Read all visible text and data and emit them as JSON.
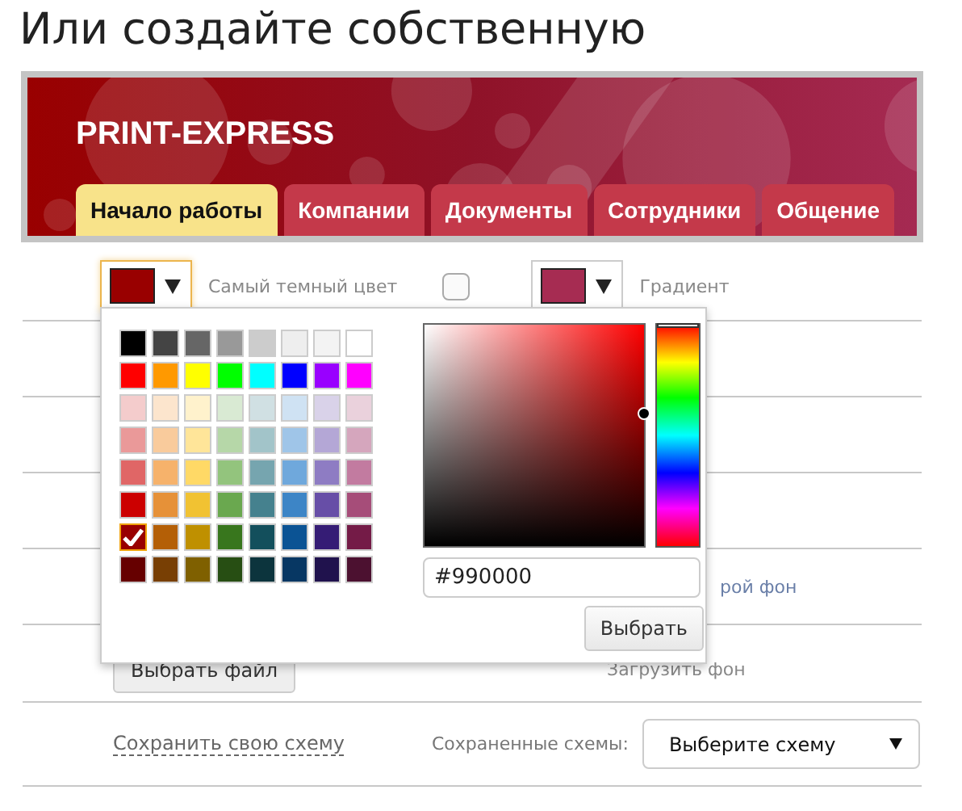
{
  "heading": "Или создайте собственную",
  "banner": {
    "logo": "PRINT-EXPRESS",
    "tabs": [
      {
        "label": "Начало работы",
        "selected": true
      },
      {
        "label": "Компании",
        "selected": false
      },
      {
        "label": "Документы",
        "selected": false
      },
      {
        "label": "Сотрудники",
        "selected": false
      },
      {
        "label": "Общение",
        "selected": false
      }
    ]
  },
  "color_row": {
    "darkest": {
      "color": "#990000",
      "label": "Самый темный цвет"
    },
    "gradient_checkbox": {
      "checked": false
    },
    "gradient": {
      "color": "#a62c52",
      "label": "Градиент"
    }
  },
  "picker": {
    "palette": [
      [
        {
          "color": "#000000",
          "selected": false
        },
        {
          "color": "#444444",
          "selected": false
        },
        {
          "color": "#666666",
          "selected": false
        },
        {
          "color": "#999999",
          "selected": false
        },
        {
          "color": "#cccccc",
          "selected": false
        },
        {
          "color": "#eeeeee",
          "selected": false
        },
        {
          "color": "#f3f3f3",
          "selected": false
        },
        {
          "color": "#ffffff",
          "selected": false
        }
      ],
      [
        {
          "color": "#ff0000",
          "selected": false
        },
        {
          "color": "#ff9900",
          "selected": false
        },
        {
          "color": "#ffff00",
          "selected": false
        },
        {
          "color": "#00ff00",
          "selected": false
        },
        {
          "color": "#00ffff",
          "selected": false
        },
        {
          "color": "#0000ff",
          "selected": false
        },
        {
          "color": "#9900ff",
          "selected": false
        },
        {
          "color": "#ff00ff",
          "selected": false
        }
      ],
      [
        {
          "color": "#f4cccc",
          "selected": false
        },
        {
          "color": "#fce5cd",
          "selected": false
        },
        {
          "color": "#fff2cc",
          "selected": false
        },
        {
          "color": "#d9ead3",
          "selected": false
        },
        {
          "color": "#d0e0e3",
          "selected": false
        },
        {
          "color": "#cfe2f3",
          "selected": false
        },
        {
          "color": "#d9d2e9",
          "selected": false
        },
        {
          "color": "#ead1dc",
          "selected": false
        }
      ],
      [
        {
          "color": "#ea9999",
          "selected": false
        },
        {
          "color": "#f9cb9c",
          "selected": false
        },
        {
          "color": "#ffe599",
          "selected": false
        },
        {
          "color": "#b6d7a8",
          "selected": false
        },
        {
          "color": "#a2c4c9",
          "selected": false
        },
        {
          "color": "#9fc5e8",
          "selected": false
        },
        {
          "color": "#b4a7d6",
          "selected": false
        },
        {
          "color": "#d5a6bd",
          "selected": false
        }
      ],
      [
        {
          "color": "#e06666",
          "selected": false
        },
        {
          "color": "#f6b26b",
          "selected": false
        },
        {
          "color": "#ffd966",
          "selected": false
        },
        {
          "color": "#93c47d",
          "selected": false
        },
        {
          "color": "#76a5af",
          "selected": false
        },
        {
          "color": "#6fa8dc",
          "selected": false
        },
        {
          "color": "#8e7cc3",
          "selected": false
        },
        {
          "color": "#c27ba0",
          "selected": false
        }
      ],
      [
        {
          "color": "#cc0000",
          "selected": false
        },
        {
          "color": "#e69138",
          "selected": false
        },
        {
          "color": "#f1c232",
          "selected": false
        },
        {
          "color": "#6aa84f",
          "selected": false
        },
        {
          "color": "#45818e",
          "selected": false
        },
        {
          "color": "#3d85c6",
          "selected": false
        },
        {
          "color": "#674ea7",
          "selected": false
        },
        {
          "color": "#a64d79",
          "selected": false
        }
      ],
      [
        {
          "color": "#990000",
          "selected": true
        },
        {
          "color": "#b45f06",
          "selected": false
        },
        {
          "color": "#bf9000",
          "selected": false
        },
        {
          "color": "#38761d",
          "selected": false
        },
        {
          "color": "#134f5c",
          "selected": false
        },
        {
          "color": "#0b5394",
          "selected": false
        },
        {
          "color": "#351c75",
          "selected": false
        },
        {
          "color": "#741b47",
          "selected": false
        }
      ],
      [
        {
          "color": "#660000",
          "selected": false
        },
        {
          "color": "#783f04",
          "selected": false
        },
        {
          "color": "#7f6000",
          "selected": false
        },
        {
          "color": "#274e13",
          "selected": false
        },
        {
          "color": "#0c343d",
          "selected": false
        },
        {
          "color": "#073763",
          "selected": false
        },
        {
          "color": "#20124d",
          "selected": false
        },
        {
          "color": "#4c1130",
          "selected": false
        }
      ]
    ],
    "hue": {
      "level": 0
    },
    "hex_value": "#990000",
    "choose_button": "Выбрать"
  },
  "background_row": {
    "label": "рой фон"
  },
  "upload_row": {
    "file_button": "Выбрать файл",
    "label": "Загрузить фон"
  },
  "scheme_row": {
    "save_link": "Сохранить свою схему",
    "saved_label": "Сохраненные схемы:",
    "select_value": "Выберите схему"
  }
}
